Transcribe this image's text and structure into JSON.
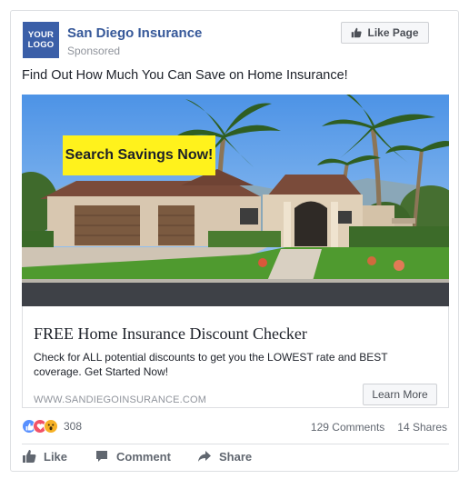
{
  "header": {
    "logo_line1": "YOUR",
    "logo_line2": "LOGO",
    "page_name": "San Diego Insurance",
    "sponsored": "Sponsored",
    "like_page_label": "Like Page"
  },
  "post_text": "Find Out How Much You Can Save on Home Insurance!",
  "image": {
    "badge_text": "Search Savings Now!",
    "badge_color": "#fff21c"
  },
  "link": {
    "headline": "FREE Home Insurance Discount Checker",
    "description": "Check for ALL potential discounts to get you the LOWEST rate and BEST coverage. Get Started Now!",
    "domain": "WWW.SANDIEGOINSURANCE.COM",
    "cta_label": "Learn More"
  },
  "engagement": {
    "reaction_icons": [
      "like-icon",
      "love-icon",
      "wow-icon"
    ],
    "reaction_count": "308",
    "comments": "129 Comments",
    "shares": "14 Shares"
  },
  "actions": {
    "like": "Like",
    "comment": "Comment",
    "share": "Share"
  },
  "colors": {
    "brand_blue": "#365899",
    "logo_bg": "#3b5fa8",
    "muted": "#90949c"
  }
}
